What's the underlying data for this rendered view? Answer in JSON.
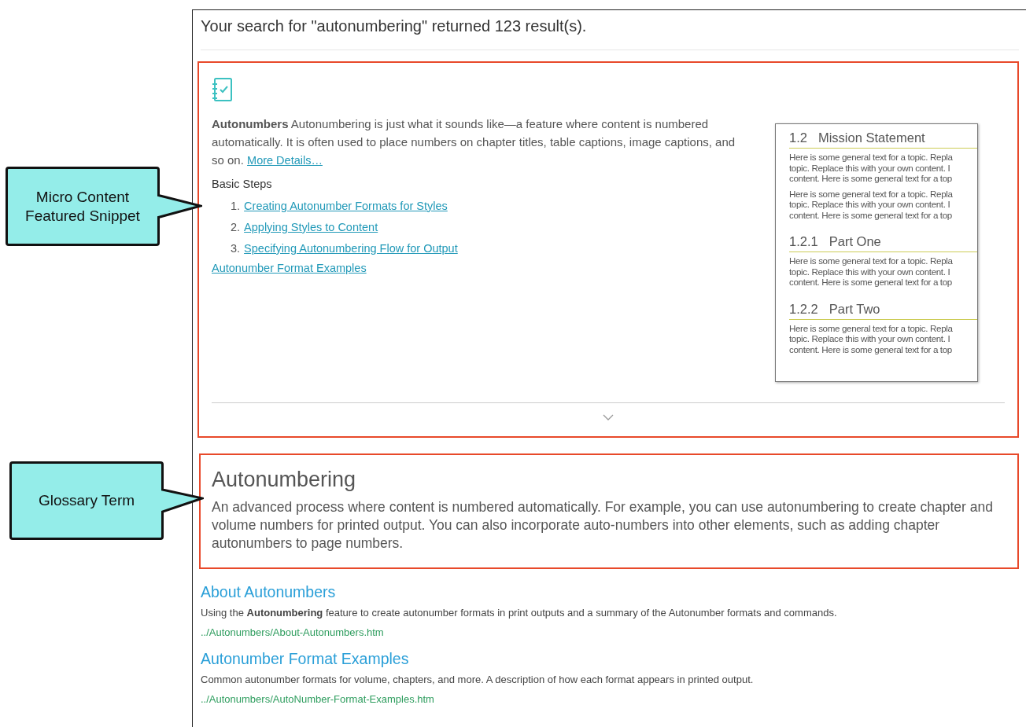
{
  "search_summary": "Your search for \"autonumbering\" returned 123 result(s).",
  "callouts": [
    {
      "lines": [
        "Micro Content",
        "Featured Snippet"
      ]
    },
    {
      "lines": [
        "Glossary Term"
      ]
    }
  ],
  "snippet": {
    "text": "**Autonumbers** Autonumbering is just what it sounds like—a feature where content is numbered automatically. It is often used to place numbers on chapter titles, table captions, image captions, and so on.",
    "more_link": "More Details…",
    "steps_heading": "Basic Steps",
    "steps": [
      {
        "number": "1.",
        "link": "Creating Autonumber Formats for Styles"
      },
      {
        "number": "2.",
        "link": "Applying Styles to Content"
      },
      {
        "number": "3.",
        "link": "Specifying Autonumbering Flow for Output"
      }
    ],
    "extra_link": "Autonumber Format Examples",
    "preview": {
      "sections": [
        {
          "number": "1.2",
          "heading": "Mission Statement",
          "paragraphs": [
            [
              "Here is some general text for a topic. Repla",
              "topic. Replace this with your own content. I",
              "content. Here is some general text for a top"
            ],
            [
              "Here is some general text for a topic. Repla",
              "topic. Replace this with your own content. I",
              "content. Here is some general text for a top"
            ]
          ]
        },
        {
          "number": "1.2.1",
          "heading": "Part One",
          "paragraphs": [
            [
              "Here is some general text for a topic. Repla",
              "topic. Replace this with your own content. I",
              "content. Here is some general text for a top"
            ]
          ]
        },
        {
          "number": "1.2.2",
          "heading": "Part Two",
          "paragraphs": [
            [
              "Here is some general text for a topic. Repla",
              "topic. Replace this with your own content. I",
              "content. Here is some general text for a top"
            ]
          ]
        }
      ]
    }
  },
  "glossary": {
    "term": "Autonumbering",
    "definition": "An advanced process where content is numbered automatically. For example, you can use autonumbering to create chapter and volume numbers for printed output. You can also incorporate auto-numbers into other elements, such as adding chapter autonumbers to page numbers."
  },
  "results": [
    {
      "title": "About Autonumbers",
      "summary": "Using the **Autonumbering** feature to create autonumber formats in print outputs and a summary of the Autonumber formats and commands.",
      "path": "../Autonumbers/About-Autonumbers.htm"
    },
    {
      "title": "Autonumber Format Examples",
      "summary": "Common autonumber formats for volume, chapters, and more. A description of how each format appears in printed output.",
      "path": "../Autonumbers/AutoNumber-Format-Examples.htm"
    }
  ]
}
